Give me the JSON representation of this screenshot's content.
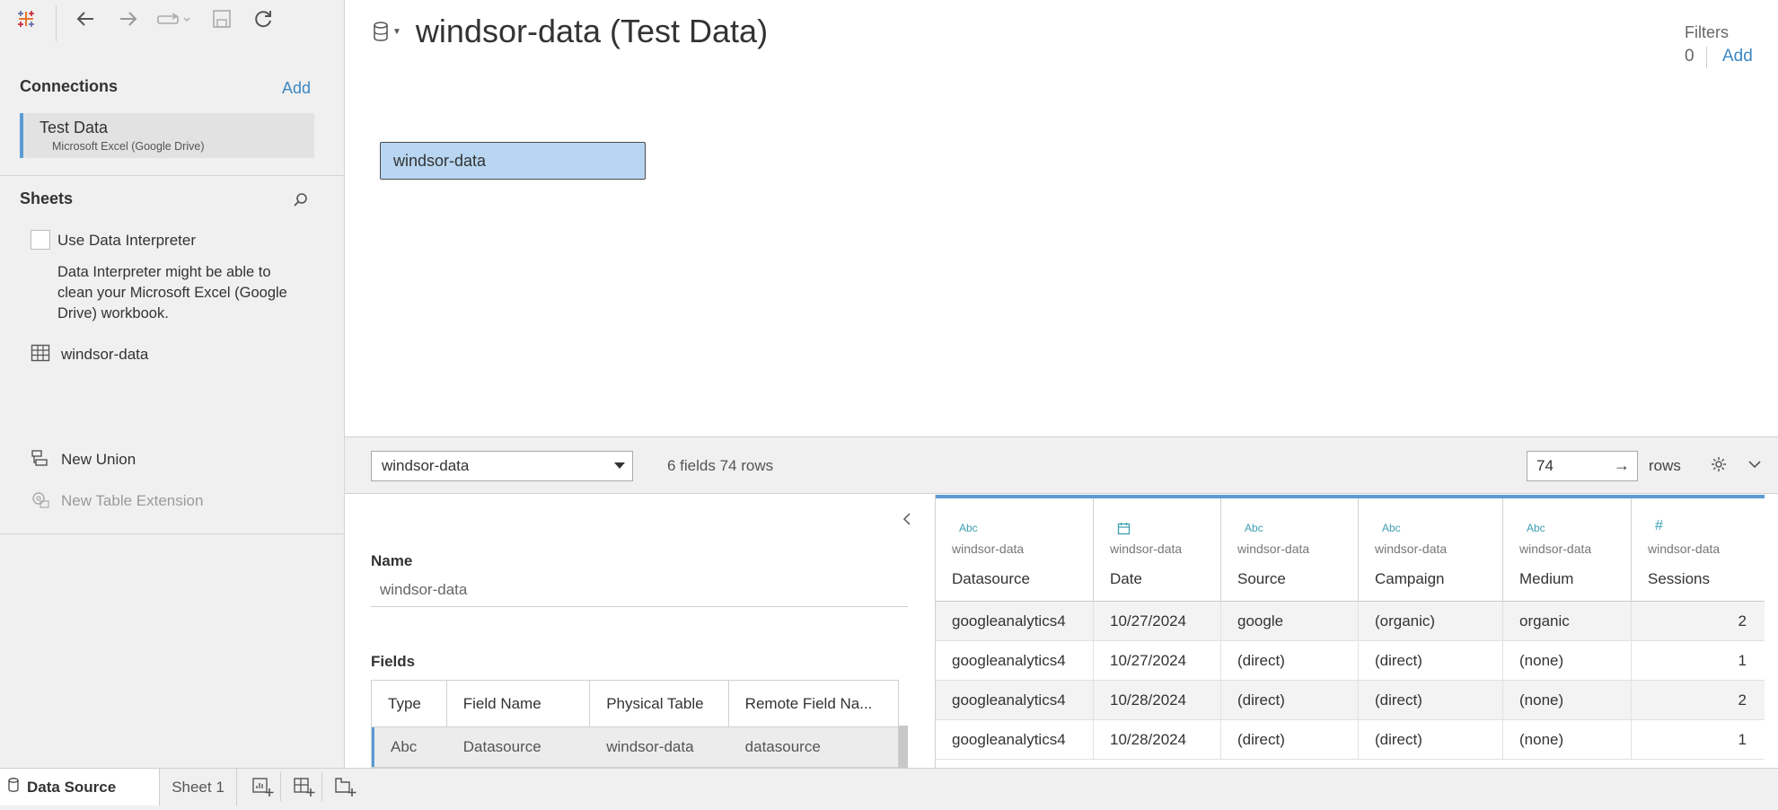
{
  "toolbar": {
    "icons": [
      "tableau-logo-icon",
      "back-arrow-icon",
      "forward-arrow-icon",
      "redo-icon",
      "save-icon",
      "refresh-icon"
    ]
  },
  "connections": {
    "title": "Connections",
    "add_label": "Add",
    "item": {
      "name": "Test Data",
      "subtitle": "Microsoft Excel (Google Drive)"
    }
  },
  "sheets": {
    "title": "Sheets",
    "interpreter_label": "Use Data Interpreter",
    "interpreter_desc": "Data Interpreter might be able to clean your Microsoft Excel (Google Drive) workbook.",
    "table_name": "windsor-data",
    "new_union": "New Union",
    "new_table_extension": "New Table Extension"
  },
  "header": {
    "title": "windsor-data (Test Data)",
    "filters_title": "Filters",
    "filters_count": "0",
    "filters_add": "Add"
  },
  "canvas": {
    "table_chip": "windsor-data"
  },
  "midbar": {
    "selected_table": "windsor-data",
    "fields_info": "6 fields 74 rows",
    "rows_value": "74",
    "rows_label": "rows"
  },
  "metadata": {
    "name_label": "Name",
    "name_value": "windsor-data",
    "fields_label": "Fields",
    "columns": [
      "Type",
      "Field Name",
      "Physical Table",
      "Remote Field Na..."
    ],
    "first_row": [
      "Abc",
      "Datasource",
      "windsor-data",
      "datasource"
    ]
  },
  "grid": {
    "columns": [
      {
        "type": "Abc",
        "source": "windsor-data",
        "name": "Datasource"
      },
      {
        "type": "date-icon",
        "source": "windsor-data",
        "name": "Date"
      },
      {
        "type": "Abc",
        "source": "windsor-data",
        "name": "Source"
      },
      {
        "type": "Abc",
        "source": "windsor-data",
        "name": "Campaign"
      },
      {
        "type": "Abc",
        "source": "windsor-data",
        "name": "Medium"
      },
      {
        "type": "#",
        "source": "windsor-data",
        "name": "Sessions"
      }
    ],
    "rows": [
      [
        "googleanalytics4",
        "10/27/2024",
        "google",
        "(organic)",
        "organic",
        "2"
      ],
      [
        "googleanalytics4",
        "10/27/2024",
        "(direct)",
        "(direct)",
        "(none)",
        "1"
      ],
      [
        "googleanalytics4",
        "10/28/2024",
        "(direct)",
        "(direct)",
        "(none)",
        "2"
      ],
      [
        "googleanalytics4",
        "10/28/2024",
        "(direct)",
        "(direct)",
        "(none)",
        "1"
      ]
    ]
  },
  "tabs": {
    "data_source": "Data Source",
    "sheet1": "Sheet 1",
    "icons": [
      "new-worksheet-icon",
      "new-dashboard-icon",
      "new-story-icon"
    ]
  },
  "colors": {
    "accent_blue": "#5b9bd5",
    "link_blue": "#3b88c3",
    "chip_fill": "#b8d6f1",
    "type_teal": "#3c9fb3"
  }
}
